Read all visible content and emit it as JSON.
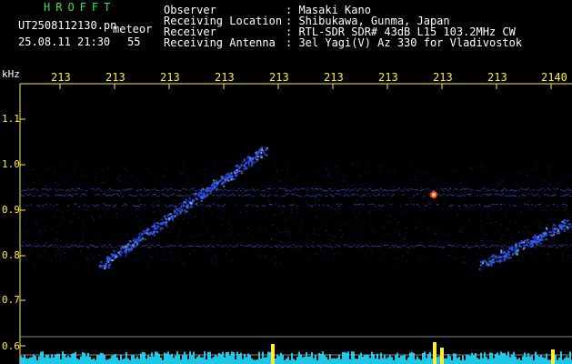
{
  "header": {
    "brand": "HROFFT",
    "filename": "UT2508112130.pn",
    "meteor_label": "meteor",
    "datetime": "25.08.11 21:30",
    "count": "55",
    "fields": [
      {
        "label": "Observer",
        "value": ": Masaki Kano"
      },
      {
        "label": "Receiving Location",
        "value": ": Shibukawa, Gunma, Japan"
      },
      {
        "label": "Receiver",
        "value": ": RTL-SDR SDR# 43dB L15 103.2MHz CW"
      },
      {
        "label": "Receiving Antenna",
        "value": ": 3el Yagi(V) Az 330 for Vladivostok"
      }
    ]
  },
  "axis": {
    "unit": "kHz",
    "time_ticks": [
      "213",
      "213",
      "213",
      "213",
      "213",
      "213",
      "213",
      "213",
      "213",
      "2140"
    ],
    "freq_ticks": [
      "1.1",
      "1.0",
      "0.9",
      "0.8",
      "0.7",
      "0.6"
    ]
  },
  "colors": {
    "tick": "#ffee33",
    "brand": "#34e04a",
    "signal": "#2f5bff",
    "spectrum": "#22ddff",
    "peak": "#ffee33"
  }
}
